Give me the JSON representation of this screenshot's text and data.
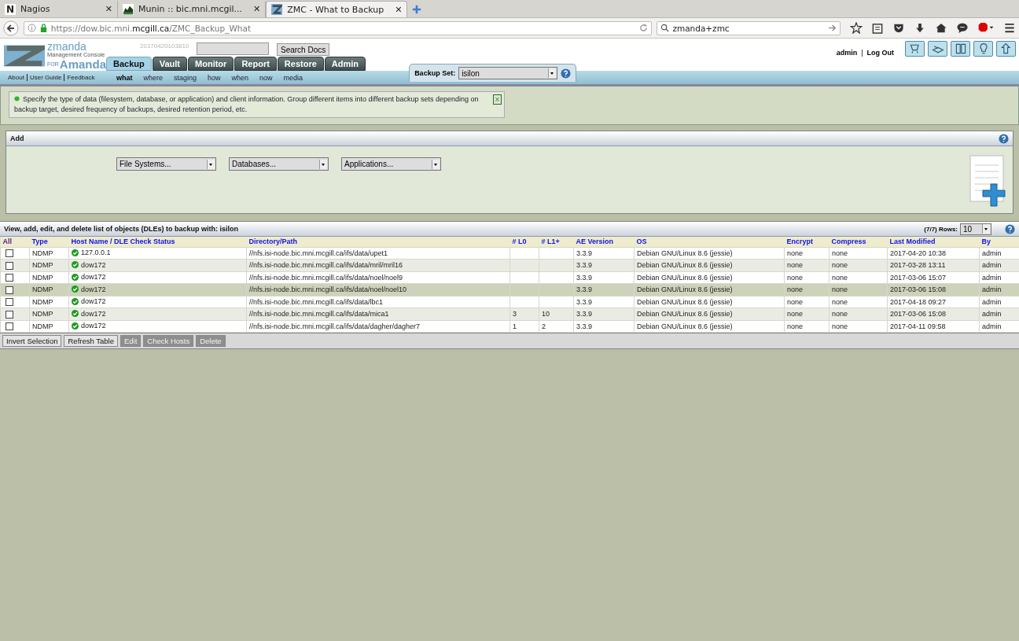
{
  "browser": {
    "tabs": [
      {
        "title": "Nagios",
        "selected": false,
        "glyph": "N",
        "close": "✕"
      },
      {
        "title": "Munin :: bic.mni.mcgil...",
        "selected": false,
        "close": "✕"
      },
      {
        "title": "ZMC - What to Backup",
        "selected": true,
        "close": "✕"
      }
    ],
    "url": {
      "prefix": "https://dow.bic.mni.",
      "domain": "mcgill.ca",
      "path": "/ZMC_Backup_What"
    },
    "search": "zmanda+zmc"
  },
  "header": {
    "logo": {
      "brand": "zmanda",
      "subtitle": "Management Console",
      "for": "FOR",
      "product": "Amanda"
    },
    "build": "20170420103810",
    "search_button": "Search Docs",
    "user": "admin",
    "separator": "|",
    "logout": "Log Out",
    "help_links": [
      "About",
      "User Guide",
      "Feedback"
    ],
    "tabs": [
      {
        "label": "Backup",
        "selected": true
      },
      {
        "label": "Vault",
        "selected": false
      },
      {
        "label": "Monitor",
        "selected": false
      },
      {
        "label": "Report",
        "selected": false
      },
      {
        "label": "Restore",
        "selected": false
      },
      {
        "label": "Admin",
        "selected": false
      }
    ],
    "subtabs": [
      {
        "label": "what",
        "selected": true
      },
      {
        "label": "where",
        "selected": false
      },
      {
        "label": "staging",
        "selected": false
      },
      {
        "label": "how",
        "selected": false
      },
      {
        "label": "when",
        "selected": false
      },
      {
        "label": "now",
        "selected": false
      },
      {
        "label": "media",
        "selected": false
      }
    ],
    "backup_set": {
      "label": "Backup Set:",
      "value": "isilon"
    }
  },
  "notice": {
    "text": "Specify the type of data (filesystem, database, or application) and client information. Group different items into different backup sets depending on backup target, desired frequency of backups, desired retention period, etc.",
    "close": "X"
  },
  "add_panel": {
    "title": "Add",
    "selects": [
      "File Systems...",
      "Databases...",
      "Applications..."
    ]
  },
  "table": {
    "title": "View, add, edit, and delete list of objects (DLEs) to backup with: isilon",
    "count": "(7/7) Rows:",
    "rows_per_page": "10",
    "columns": [
      "All",
      "Type",
      "Host Name / DLE Check Status",
      "Directory/Path",
      "# L0",
      "# L1+",
      "AE Version",
      "OS",
      "Encrypt",
      "Compress",
      "Last Modified",
      "By"
    ],
    "rows": [
      {
        "checked": false,
        "selected": false,
        "type": "NDMP",
        "host": "127.0.0.1",
        "path": "//nfs.isi-node.bic.mni.mcgill.ca/ifs/data/upet1",
        "l0": "",
        "l1": "",
        "ae": "3.3.9",
        "os": "Debian GNU/Linux 8.6 (jessie)",
        "encrypt": "none",
        "compress": "none",
        "modified": "2017-04-20 10:38",
        "by": "admin"
      },
      {
        "checked": false,
        "selected": false,
        "type": "NDMP",
        "host": "dow172",
        "path": "//nfs.isi-node.bic.mni.mcgill.ca/ifs/data/mril/mril16",
        "l0": "",
        "l1": "",
        "ae": "3.3.9",
        "os": "Debian GNU/Linux 8.6 (jessie)",
        "encrypt": "none",
        "compress": "none",
        "modified": "2017-03-28 13:11",
        "by": "admin"
      },
      {
        "checked": false,
        "selected": false,
        "type": "NDMP",
        "host": "dow172",
        "path": "//nfs.isi-node.bic.mni.mcgill.ca/ifs/data/noel/noel9",
        "l0": "",
        "l1": "",
        "ae": "3.3.9",
        "os": "Debian GNU/Linux 8.6 (jessie)",
        "encrypt": "none",
        "compress": "none",
        "modified": "2017-03-06 15:07",
        "by": "admin"
      },
      {
        "checked": false,
        "selected": true,
        "type": "NDMP",
        "host": "dow172",
        "path": "//nfs.isi-node.bic.mni.mcgill.ca/ifs/data/noel/noel10",
        "l0": "",
        "l1": "",
        "ae": "3.3.9",
        "os": "Debian GNU/Linux 8.6 (jessie)",
        "encrypt": "none",
        "compress": "none",
        "modified": "2017-03-06 15:08",
        "by": "admin"
      },
      {
        "checked": false,
        "selected": false,
        "type": "NDMP",
        "host": "dow172",
        "path": "//nfs.isi-node.bic.mni.mcgill.ca/ifs/data/lbc1",
        "l0": "",
        "l1": "",
        "ae": "3.3.9",
        "os": "Debian GNU/Linux 8.6 (jessie)",
        "encrypt": "none",
        "compress": "none",
        "modified": "2017-04-18 09:27",
        "by": "admin"
      },
      {
        "checked": false,
        "selected": false,
        "type": "NDMP",
        "host": "dow172",
        "path": "//nfs.isi-node.bic.mni.mcgill.ca/ifs/data/mica1",
        "l0": "3",
        "l1": "10",
        "ae": "3.3.9",
        "os": "Debian GNU/Linux 8.6 (jessie)",
        "encrypt": "none",
        "compress": "none",
        "modified": "2017-03-06 15:08",
        "by": "admin"
      },
      {
        "checked": false,
        "selected": false,
        "type": "NDMP",
        "host": "dow172",
        "path": "//nfs.isi-node.bic.mni.mcgill.ca/ifs/data/dagher/dagher7",
        "l0": "1",
        "l1": "2",
        "ae": "3.3.9",
        "os": "Debian GNU/Linux 8.6 (jessie)",
        "encrypt": "none",
        "compress": "none",
        "modified": "2017-04-11 09:58",
        "by": "admin"
      }
    ],
    "buttons": [
      {
        "label": "Invert Selection",
        "disabled": false
      },
      {
        "label": "Refresh Table",
        "disabled": false
      },
      {
        "label": "Edit",
        "disabled": true
      },
      {
        "label": "Check Hosts",
        "disabled": true
      },
      {
        "label": "Delete",
        "disabled": true
      }
    ]
  }
}
